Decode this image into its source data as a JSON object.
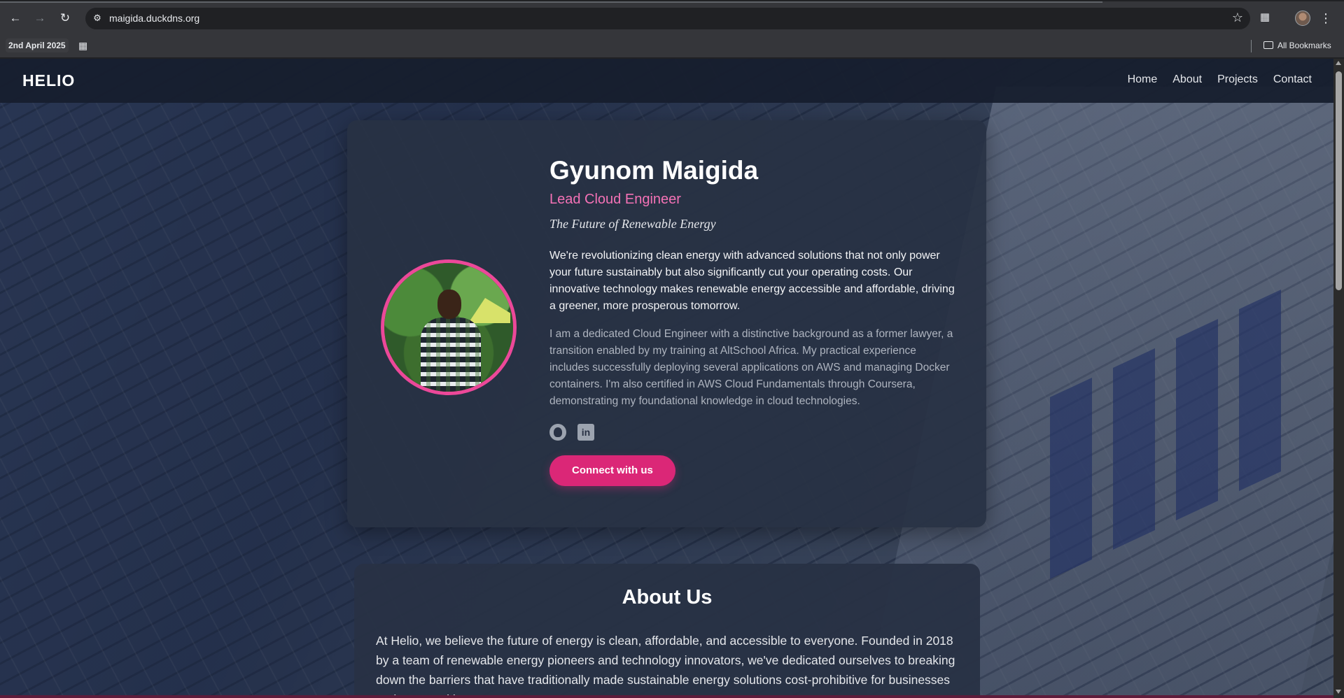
{
  "browser": {
    "url": "maigida.duckdns.org",
    "bookmark_date": "2nd April 2025",
    "all_bookmarks_label": "All Bookmarks"
  },
  "site": {
    "logo": "HELIO",
    "nav": [
      "Home",
      "About",
      "Projects",
      "Contact"
    ]
  },
  "hero": {
    "name": "Gyunom Maigida",
    "role": "Lead Cloud Engineer",
    "tagline": "The Future of Renewable Energy",
    "lead": "We're revolutionizing clean energy with advanced solutions that not only power your future sustainably but also significantly cut your operating costs. Our innovative technology makes renewable energy accessible and affordable, driving a greener, more prosperous tomorrow.",
    "bio": "I am a dedicated Cloud Engineer with a distinctive background as a former lawyer, a transition enabled by my training at AltSchool Africa. My practical experience includes successfully deploying several applications on AWS and managing Docker containers. I'm also certified in AWS Cloud Fundamentals through Coursera, demonstrating my foundational knowledge in cloud technologies.",
    "social_icons": [
      "github-icon",
      "linkedin-icon"
    ],
    "linkedin_glyph": "in",
    "cta_label": "Connect with us"
  },
  "about": {
    "title": "About Us",
    "body": "At Helio, we believe the future of energy is clean, affordable, and accessible to everyone. Founded in 2018 by a team of renewable energy pioneers and technology innovators, we've dedicated ourselves to breaking down the barriers that have traditionally made sustainable energy solutions cost-prohibitive for businesses and communities."
  },
  "colors": {
    "accent": "#ec4899",
    "cta": "#db2777",
    "card": "#283144",
    "nav_bg": "#161e2e"
  }
}
